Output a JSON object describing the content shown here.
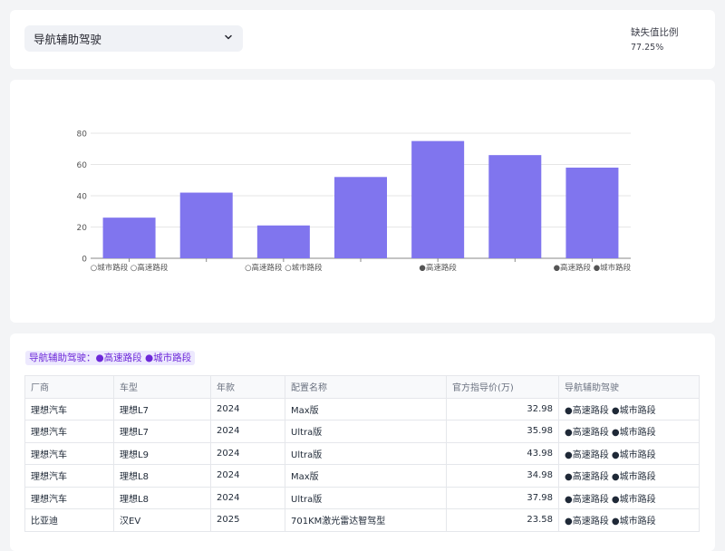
{
  "filter": {
    "selected": "导航辅助驾驶"
  },
  "metric": {
    "label": "缺失值比例",
    "value": "77.25%"
  },
  "tag": {
    "text": "导航辅助驾驶：●高速路段 ●城市路段"
  },
  "chart_data": {
    "type": "bar",
    "categories": [
      "○城市路段 ○高速路段",
      "",
      "○高速路段 ○城市路段",
      "",
      "●高速路段",
      "",
      "●高速路段 ●城市路段"
    ],
    "values": [
      26,
      42,
      21,
      52,
      75,
      66,
      58
    ],
    "ylim": [
      0,
      80
    ],
    "yticks": [
      0,
      20,
      40,
      60,
      80
    ],
    "grid": true,
    "bar_color": "#8075ee"
  },
  "table": {
    "headers": [
      "厂商",
      "车型",
      "年款",
      "配置名称",
      "官方指导价(万)",
      "导航辅助驾驶"
    ],
    "rows": [
      [
        "理想汽车",
        "理想L7",
        "2024",
        "Max版",
        "32.98",
        "●高速路段 ●城市路段"
      ],
      [
        "理想汽车",
        "理想L7",
        "2024",
        "Ultra版",
        "35.98",
        "●高速路段 ●城市路段"
      ],
      [
        "理想汽车",
        "理想L9",
        "2024",
        "Ultra版",
        "43.98",
        "●高速路段 ●城市路段"
      ],
      [
        "理想汽车",
        "理想L8",
        "2024",
        "Max版",
        "34.98",
        "●高速路段 ●城市路段"
      ],
      [
        "理想汽车",
        "理想L8",
        "2024",
        "Ultra版",
        "37.98",
        "●高速路段 ●城市路段"
      ],
      [
        "比亚迪",
        "汉EV",
        "2025",
        "701KM激光雷达智驾型",
        "23.58",
        "●高速路段 ●城市路段"
      ]
    ]
  }
}
